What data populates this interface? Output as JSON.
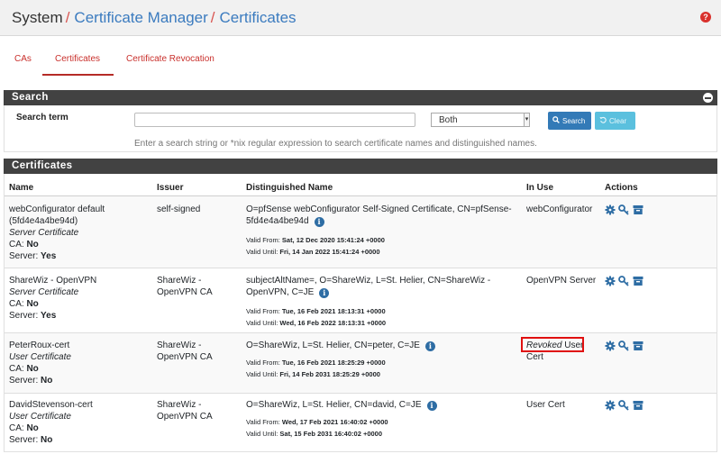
{
  "breadcrumb": {
    "items": [
      "System",
      "Certificate Manager",
      "Certificates"
    ],
    "separator": "/"
  },
  "help_icon": "help-icon",
  "tabs": [
    {
      "label": "CAs",
      "active": false
    },
    {
      "label": "Certificates",
      "active": true
    },
    {
      "label": "Certificate Revocation",
      "active": false
    }
  ],
  "search": {
    "panel_title": "Search",
    "term_label": "Search term",
    "term_value": "",
    "scope_selected": "Both",
    "search_button": "Search",
    "clear_button": "Clear",
    "hint": "Enter a search string or *nix regular expression to search certificate names and distinguished names."
  },
  "certificates": {
    "panel_title": "Certificates",
    "columns": [
      "Name",
      "Issuer",
      "Distinguished Name",
      "In Use",
      "Actions"
    ],
    "rows": [
      {
        "name": "webConfigurator default (5fd4e4a4be94d)",
        "type": "Server Certificate",
        "ca_label": "CA:",
        "ca": "No",
        "server_label": "Server:",
        "server": "Yes",
        "issuer": "self-signed",
        "dn": "O=pfSense webConfigurator Self-Signed Certificate, CN=pfSense-5fd4e4a4be94d",
        "valid_from_label": "Valid From:",
        "valid_from": "Sat, 12 Dec 2020 15:41:24 +0000",
        "valid_until_label": "Valid Until:",
        "valid_until": "Fri, 14 Jan 2022 15:41:24 +0000",
        "in_use": "webConfigurator",
        "actions": [
          "gear-icon",
          "key-icon",
          "archive-icon"
        ]
      },
      {
        "name": "ShareWiz - OpenVPN",
        "type": "Server Certificate",
        "ca_label": "CA:",
        "ca": "No",
        "server_label": "Server:",
        "server": "Yes",
        "issuer": "ShareWiz - OpenVPN CA",
        "dn": "subjectAltName=, O=ShareWiz, L=St. Helier, CN=ShareWiz - OpenVPN, C=JE",
        "valid_from_label": "Valid From:",
        "valid_from": "Tue, 16 Feb 2021 18:13:31 +0000",
        "valid_until_label": "Valid Until:",
        "valid_until": "Wed, 16 Feb 2022 18:13:31 +0000",
        "in_use": "OpenVPN Server",
        "actions": [
          "gear-icon",
          "key-icon",
          "archive-icon"
        ]
      },
      {
        "name": "PeterRoux-cert",
        "type": "User Certificate",
        "ca_label": "CA:",
        "ca": "No",
        "server_label": "Server:",
        "server": "No",
        "issuer": "ShareWiz - OpenVPN CA",
        "dn": "O=ShareWiz, L=St. Helier, CN=peter, C=JE",
        "valid_from_label": "Valid From:",
        "valid_from": "Tue, 16 Feb 2021 18:25:29 +0000",
        "valid_until_label": "Valid Until:",
        "valid_until": "Fri, 14 Feb 2031 18:25:29 +0000",
        "in_use_revoked": "Revoked",
        "in_use": "User Cert",
        "actions": [
          "gear-icon",
          "key-icon",
          "archive-icon"
        ]
      },
      {
        "name": "DavidStevenson-cert",
        "type": "User Certificate",
        "ca_label": "CA:",
        "ca": "No",
        "server_label": "Server:",
        "server": "No",
        "issuer": "ShareWiz - OpenVPN CA",
        "dn": "O=ShareWiz, L=St. Helier, CN=david, C=JE",
        "valid_from_label": "Valid From:",
        "valid_from": "Wed, 17 Feb 2021 16:40:02 +0000",
        "valid_until_label": "Valid Until:",
        "valid_until": "Sat, 15 Feb 2031 16:40:02 +0000",
        "in_use": "User Cert",
        "actions": [
          "gear-icon",
          "key-icon",
          "archive-icon"
        ]
      }
    ]
  },
  "colors": {
    "brand_red": "#c9302c",
    "link_blue": "#3b7bbf",
    "panel_header": "#424242",
    "primary": "#337ab7",
    "info": "#5bc0de",
    "highlight": "#e01010"
  }
}
